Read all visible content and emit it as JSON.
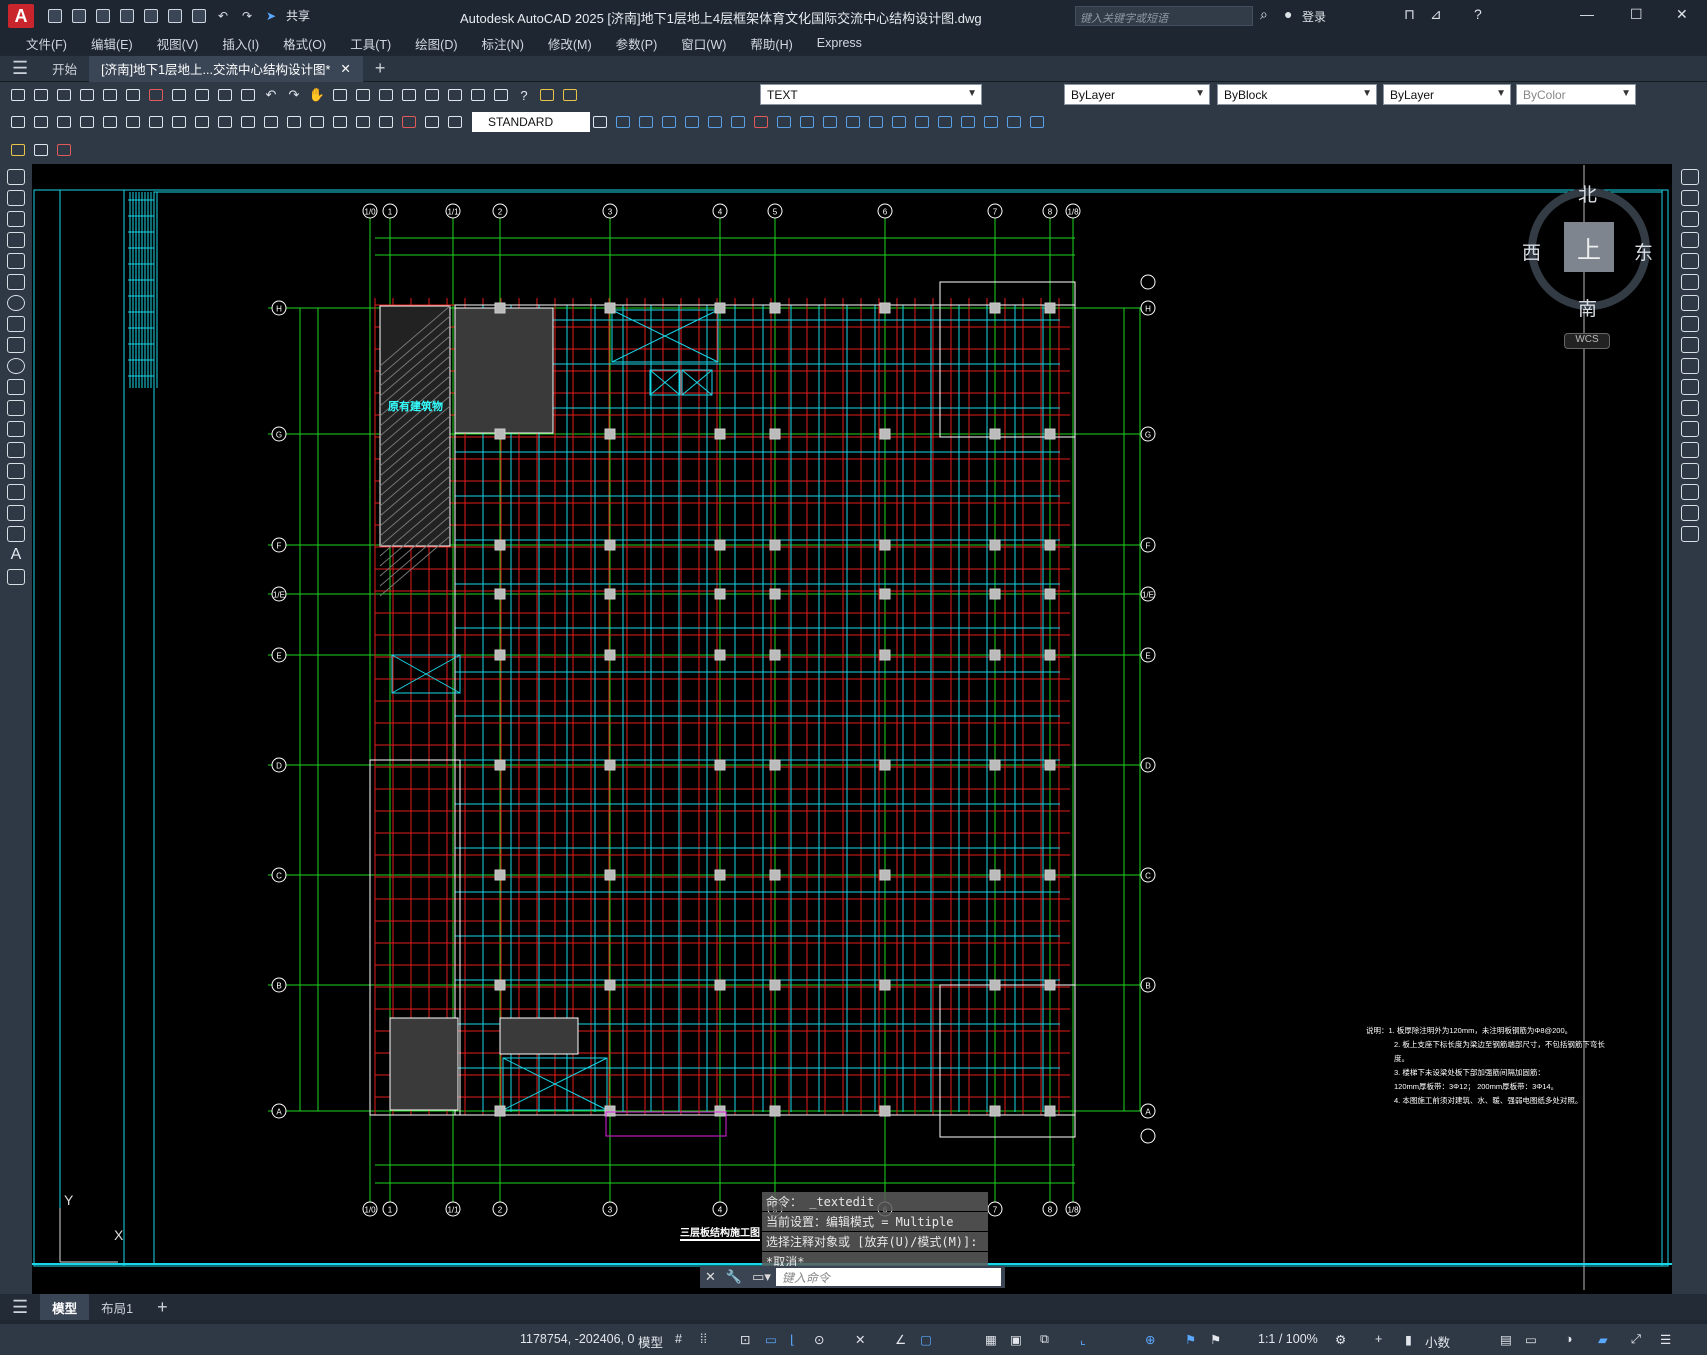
{
  "app": {
    "title": "Autodesk AutoCAD 2025    [济南]地下1层地上4层框架体育文化国际交流中心结构设计图.dwg",
    "share": "共享",
    "search_placeholder": "键入关键字或短语",
    "login": "登录"
  },
  "menu": [
    "文件(F)",
    "编辑(E)",
    "视图(V)",
    "插入(I)",
    "格式(O)",
    "工具(T)",
    "绘图(D)",
    "标注(N)",
    "修改(M)",
    "参数(P)",
    "窗口(W)",
    "帮助(H)",
    "Express"
  ],
  "tabs": {
    "start": "开始",
    "doc": "[济南]地下1层地上...交流中心结构设计图*"
  },
  "toolbar": {
    "text_style": "TEXT",
    "dim_style": "STANDARD",
    "layer": "ByLayer",
    "linetype": "ByBlock",
    "lineweight": "ByLayer",
    "color": "ByColor"
  },
  "drawing": {
    "plan_title": "三层板结构施工图",
    "existing_building": "原有建筑物",
    "notes": [
      "说明：1. 板厚除注明外为120mm，未注明板钢筋为Φ8@200。",
      "2. 板上支座下标长度为梁边至钢筋端部尺寸，不包括钢筋下弯长度。",
      "3. 楼梯下未设梁处板下部加强筋间隔加固筋：",
      "120mm厚板带：3Φ12；     200mm厚板带：3Φ14。",
      "4. 本图施工前须对建筑、水、暖、强弱电图纸多处对照。"
    ],
    "row_axes": [
      "H",
      "G",
      "F",
      "1/E",
      "E",
      "D",
      "C",
      "B",
      "A"
    ],
    "col_axes": [
      "1/0",
      "1",
      "1/1",
      "2",
      "3",
      "4",
      "5",
      "6",
      "7",
      "8",
      "1/8"
    ],
    "compass": {
      "n": "北",
      "s": "南",
      "e": "东",
      "w": "西",
      "top": "上",
      "wcs": "WCS"
    }
  },
  "command": {
    "history": [
      "命令： _textedit",
      "当前设置：编辑模式 = Multiple",
      "选择注释对象或 [放弃(U)/模式(M)]:",
      "*取消*"
    ],
    "placeholder": "键入命令"
  },
  "layout_tabs": [
    "模型",
    "布局1"
  ],
  "status": {
    "coords": "1178754, -202406, 0",
    "model": "模型",
    "scale": "1:1 / 100%",
    "units": "小数"
  }
}
